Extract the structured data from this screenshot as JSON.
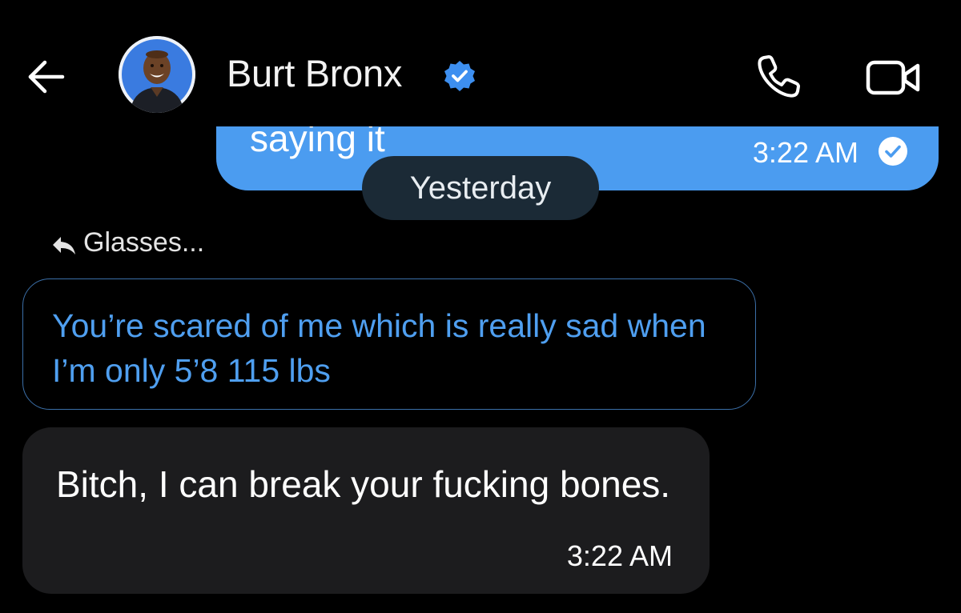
{
  "header": {
    "contact_name": "Burt Bronx",
    "icons": {
      "back": "back-arrow-icon",
      "verified": "verified-badge-icon",
      "call": "phone-icon",
      "video": "video-camera-icon"
    }
  },
  "colors": {
    "background": "#000000",
    "outgoing_bubble": "#4b9cf0",
    "incoming_bubble": "#1c1c1e",
    "quote_text": "#4f9ff0",
    "quote_border": "#3b6fa8",
    "date_pill": "#1b2a36"
  },
  "messages": {
    "outgoing_partial": {
      "text": "saying it",
      "time": "3:22 AM",
      "status_icon": "read-check-icon"
    },
    "date_separator": "Yesterday",
    "reply": {
      "label": "Glasses...",
      "icon": "reply-arrow-icon",
      "quoted_text": "You’re scared of me which is really sad when I’m only 5’8 115 lbs"
    },
    "incoming": {
      "text": "Bitch, I can break your fucking bones.",
      "time": "3:22 AM"
    }
  }
}
